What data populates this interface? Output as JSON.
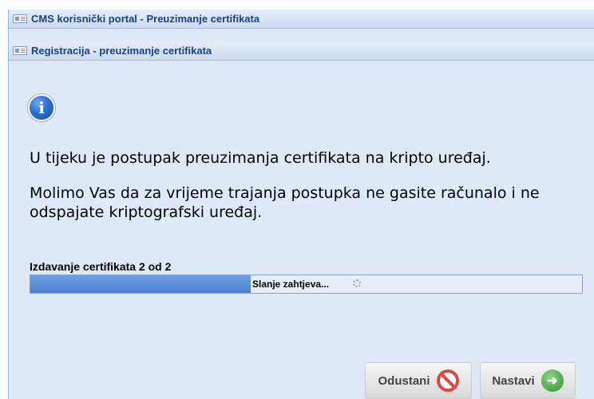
{
  "window": {
    "title": "CMS korisnički portal - Preuzimanje certifikata",
    "dialog_title": "Registracija - preuzimanje certifikata"
  },
  "content": {
    "info_icon_glyph": "i",
    "message_1": "U tijeku je postupak preuzimanja certifikata na kripto uređaj.",
    "message_2": "Molimo Vas da za vrijeme trajanja postupka ne gasite računalo i ne odspajate kriptografski uređaj."
  },
  "progress": {
    "label": "Izdavanje certifikata 2 od 2",
    "status_text": "Slanje zahtjeva...",
    "fraction": 0.4
  },
  "buttons": {
    "cancel_label": "Odustani",
    "next_label": "Nastavi",
    "next_icon_glyph": "➔"
  },
  "icons": {
    "window": "window-icon",
    "info": "info-icon",
    "cancel": "no-entry-icon",
    "next": "arrow-right-circle-icon",
    "spinner": "loading-spinner-icon"
  },
  "colors": {
    "titlebar_text": "#15428b",
    "panel_bg": "#dfe8f6",
    "progress_fill": "#5a8fd9",
    "cancel_red": "#d94a45",
    "next_green": "#4cae4c"
  }
}
